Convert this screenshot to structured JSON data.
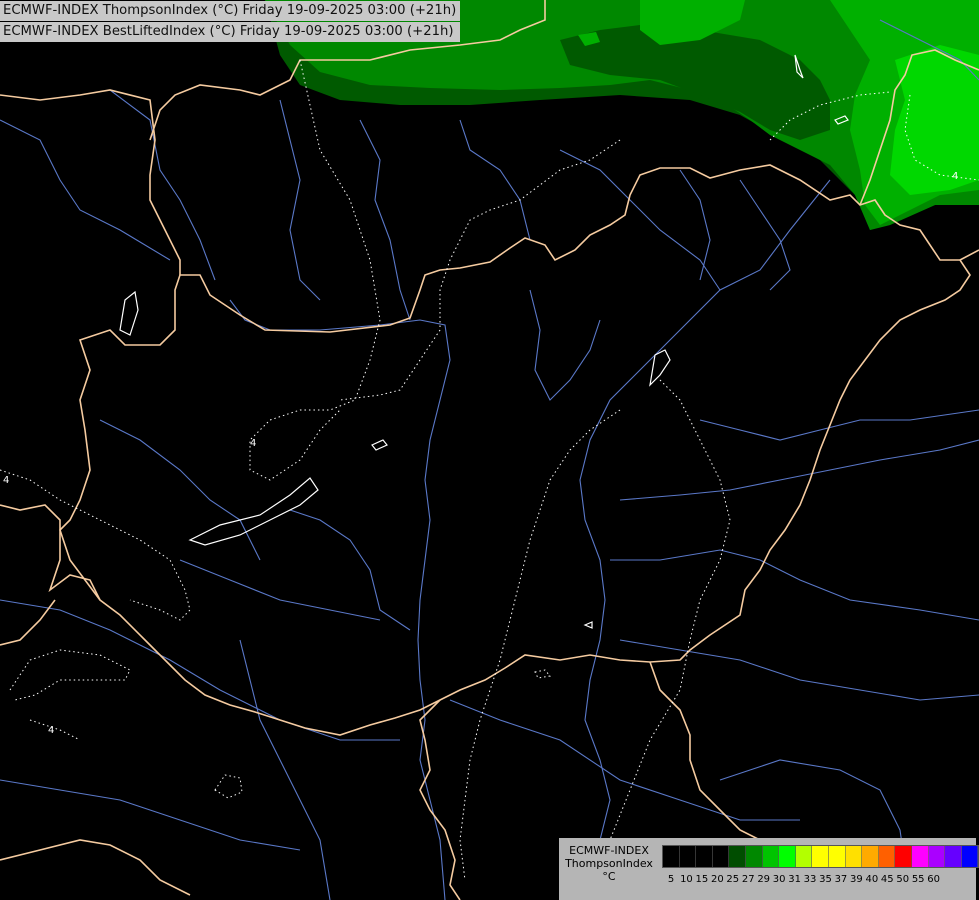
{
  "titles": [
    "ECMWF-INDEX ThompsonIndex (°C) Friday 19-09-2025 03:00 (+21h)",
    "ECMWF-INDEX BestLiftedIndex (°C) Friday 19-09-2025 03:00 (+21h)"
  ],
  "contour_labels": [
    "4",
    "4",
    "4",
    "4"
  ],
  "legend": {
    "model": "ECMWF-INDEX",
    "parameter": "ThompsonIndex",
    "unit": "°C",
    "ticks": [
      "5",
      "10",
      "15",
      "20",
      "25",
      "27",
      "29",
      "30",
      "31",
      "33",
      "35",
      "37",
      "39",
      "40",
      "45",
      "50",
      "55",
      "60"
    ],
    "colors": [
      "#000000",
      "#000000",
      "#000000",
      "#000000",
      "#004d00",
      "#008800",
      "#00c400",
      "#00ff00",
      "#b3ff00",
      "#ffff00",
      "#ffff00",
      "#ffe000",
      "#ffaa00",
      "#ff6000",
      "#ff0000",
      "#ff00ff",
      "#aa00ff",
      "#6600ff",
      "#0000ff"
    ]
  },
  "colors": {
    "background": "#000000",
    "border": "#f5cba0",
    "river": "#5a78c8",
    "isoline_dotted": "#ffffff",
    "green_dark": "#005500",
    "green_mid": "#008800",
    "green_light": "#00b800",
    "green_bright": "#00e000"
  }
}
